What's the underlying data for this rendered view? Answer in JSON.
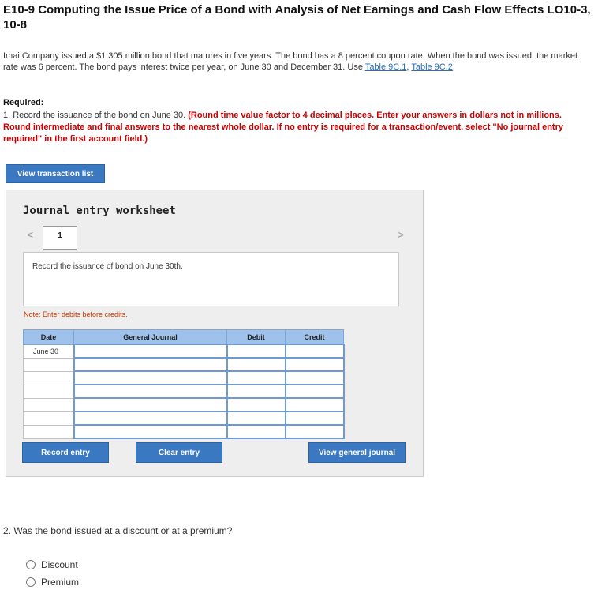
{
  "title": "E10-9 Computing the Issue Price of a Bond with Analysis of Net Earnings and Cash Flow Effects LO10-3, 10-8",
  "problem": {
    "text": "Imai Company issued a $1.305 million bond that matures in five years. The bond has a 8 percent coupon rate. When the bond was issued, the market rate was 6 percent. The bond pays interest twice per year, on June 30 and December 31. Use ",
    "link1": "Table 9C.1",
    "sep": ", ",
    "link2": "Table 9C.2",
    "end": "."
  },
  "required": {
    "heading": "Required:",
    "item1_text": "1. Record the issuance of the bond on June 30. ",
    "item1_red": "(Round time value factor to 4 decimal places. Enter your answers in dollars not in millions. Round intermediate and final answers to the nearest whole dollar. If no entry is required for a transaction/event, select \"No journal entry required\" in the first account field.)"
  },
  "buttons": {
    "view_transactions": "View transaction list",
    "record_entry": "Record entry",
    "clear_entry": "Clear entry",
    "view_journal": "View general journal"
  },
  "worksheet": {
    "title": "Journal entry worksheet",
    "nav_prev": "<",
    "nav_next": ">",
    "page": "1",
    "description": "Record the issuance of bond on June 30th.",
    "note": "Note: Enter debits before credits.",
    "columns": [
      "Date",
      "General Journal",
      "Debit",
      "Credit"
    ],
    "rows": [
      {
        "date": "June 30"
      },
      {
        "date": ""
      },
      {
        "date": ""
      },
      {
        "date": ""
      },
      {
        "date": ""
      },
      {
        "date": ""
      },
      {
        "date": ""
      }
    ]
  },
  "question2": {
    "text": "2. Was the bond issued at a discount or at a premium?",
    "options": [
      "Discount",
      "Premium"
    ]
  },
  "colors": {
    "button_blue": "#3a78c2",
    "header_blue": "#9fc2ec",
    "required_red": "#cc0000",
    "link_blue": "#2a6ebb"
  }
}
